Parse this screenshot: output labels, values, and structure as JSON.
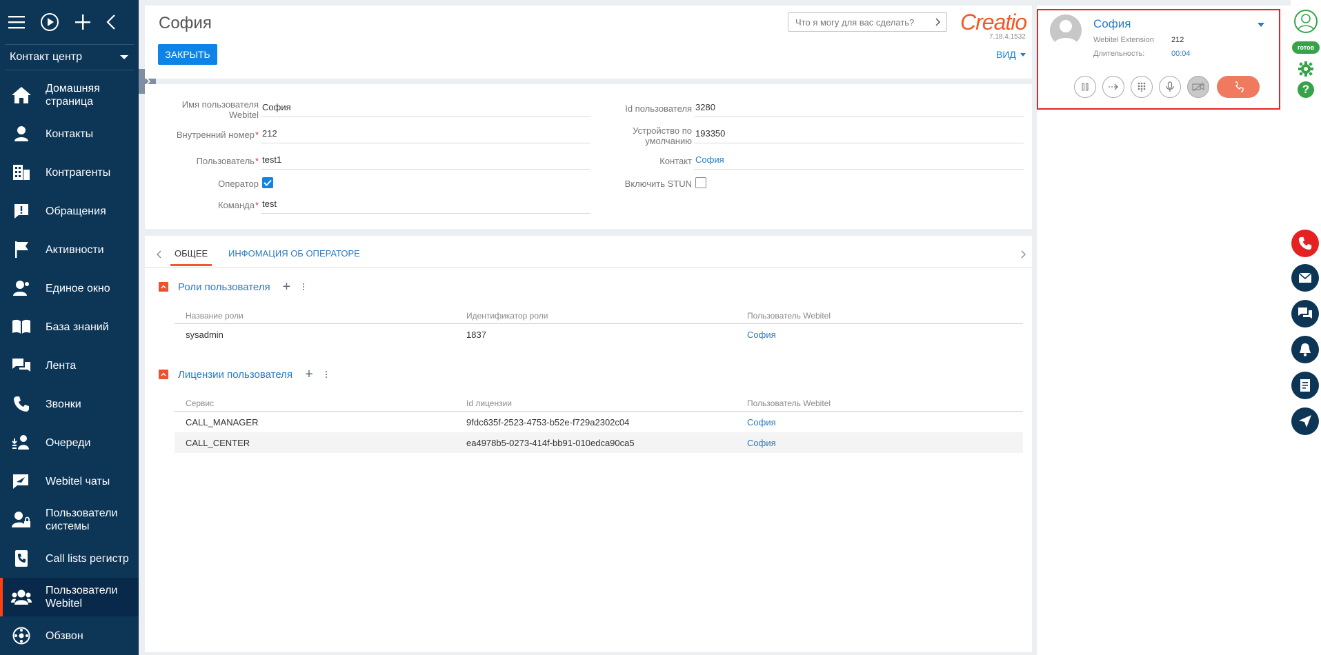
{
  "sidebar": {
    "workspace": "Контакт центр",
    "items": [
      {
        "label": "Домашняя страница",
        "icon": "home-icon"
      },
      {
        "label": "Контакты",
        "icon": "person-icon"
      },
      {
        "label": "Контрагенты",
        "icon": "building-icon"
      },
      {
        "label": "Обращения",
        "icon": "alert-icon"
      },
      {
        "label": "Активности",
        "icon": "flag-icon"
      },
      {
        "label": "Единое окно",
        "icon": "person-chat-icon"
      },
      {
        "label": "База знаний",
        "icon": "book-icon"
      },
      {
        "label": "Лента",
        "icon": "feed-icon"
      },
      {
        "label": "Звонки",
        "icon": "phone-icon"
      },
      {
        "label": "Очереди",
        "icon": "queue-icon"
      },
      {
        "label": "Webitel чаты",
        "icon": "chat-send-icon"
      },
      {
        "label": "Пользователи системы",
        "icon": "user-lock-icon"
      },
      {
        "label": "Call lists регистр",
        "icon": "call-list-icon"
      },
      {
        "label": "Пользователи Webitel",
        "icon": "users-icon"
      },
      {
        "label": "Обзвон",
        "icon": "dial-icon"
      }
    ]
  },
  "header": {
    "title": "София",
    "close_label": "ЗАКРЫТЬ",
    "search_placeholder": "Что я могу для вас сделать?",
    "logo": "Creatio",
    "version": "7.18.4.1532",
    "view_label": "ВИД"
  },
  "form": {
    "username_label": "Имя пользователя Webitel",
    "username": "София",
    "extension_label": "Внутренний номер",
    "extension": "212",
    "user_label": "Пользователь",
    "user": "test1",
    "operator_label": "Оператор",
    "team_label": "Команда",
    "team": "test",
    "user_id_label": "Id пользователя",
    "user_id": "3280",
    "device_label": "Устройство по умолчанию",
    "device": "193350",
    "contact_label": "Контакт",
    "contact": "София",
    "stun_label": "Включить STUN"
  },
  "tabs": [
    {
      "label": "ОБЩЕЕ"
    },
    {
      "label": "ИНФОМАЦИЯ ОБ ОПЕРАТОРЕ"
    }
  ],
  "roles": {
    "title": "Роли пользователя",
    "columns": [
      "Название роли",
      "Идентификатор роли",
      "Пользователь Webitel"
    ],
    "rows": [
      [
        "sysadmin",
        "1837",
        "София"
      ]
    ]
  },
  "licenses": {
    "title": "Лицензии пользователя",
    "columns": [
      "Сервис",
      "Id лицензии",
      "Пользователь Webitel"
    ],
    "rows": [
      [
        "CALL_MANAGER",
        "9fdc635f-2523-4753-b52e-f729a2302c04",
        "София"
      ],
      [
        "CALL_CENTER",
        "ea4978b5-0273-414f-bb91-010edca90ca5",
        "София"
      ]
    ]
  },
  "call": {
    "caller": "София",
    "ext_label": "Webitel Extension",
    "ext": "212",
    "duration_label": "Длительность:",
    "duration": "00:04"
  },
  "status": {
    "ready": "готов"
  },
  "colors": {
    "sidebar": "#0c3556",
    "accent": "#0e84e6",
    "brand": "#f05a28",
    "ready": "#36a348",
    "alert": "#e52222"
  }
}
